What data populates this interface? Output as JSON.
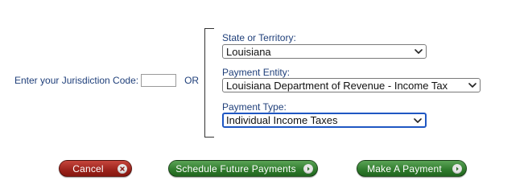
{
  "jurisdiction": {
    "label": "Enter your Jurisdiction Code:",
    "value": "",
    "or_label": "OR"
  },
  "state": {
    "label": "State or Territory:",
    "selected": "Louisiana"
  },
  "entity": {
    "label": "Payment Entity:",
    "selected": "Louisiana Department of Revenue - Income Tax"
  },
  "payment_type": {
    "label": "Payment Type:",
    "selected": "Individual Income Taxes"
  },
  "buttons": {
    "cancel": "Cancel",
    "schedule": "Schedule Future Payments",
    "pay": "Make A Payment"
  },
  "colors": {
    "label_text": "#1f3f7a",
    "cancel_button": "#9b231c",
    "action_button": "#2f7a2c",
    "focus_border": "#1f57c3"
  },
  "icons": {
    "cancel": "close-circle-icon",
    "schedule": "arrow-right-circle-icon",
    "pay": "arrow-right-circle-icon",
    "select": "chevron-down-icon"
  }
}
